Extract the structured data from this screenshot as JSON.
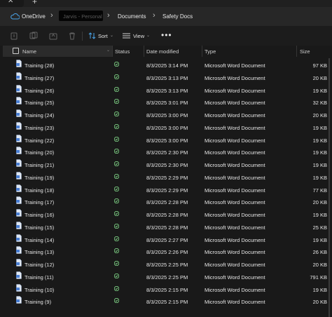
{
  "tabstrip": {
    "close": "✕",
    "new_tab": "+"
  },
  "breadcrumb": {
    "items": [
      "OneDrive",
      "Jarvis - Personal",
      "Documents",
      "Safety Docs"
    ]
  },
  "toolbar": {
    "sort_label": "Sort",
    "view_label": "View",
    "more_label": "•••"
  },
  "columns": {
    "name": "Name",
    "status": "Status",
    "date": "Date modified",
    "type": "Type",
    "size": "Size"
  },
  "colors": {
    "accent": "#4aa3e8",
    "status_ok": "#7ed185",
    "word_blue": "#4a7fd4"
  },
  "files": [
    {
      "name": "Training (28)",
      "date": "8/3/2025 3:14 PM",
      "type": "Microsoft Word Document",
      "size": "97 KB"
    },
    {
      "name": "Training (27)",
      "date": "8/3/2025 3:13 PM",
      "type": "Microsoft Word Document",
      "size": "20 KB"
    },
    {
      "name": "Training (26)",
      "date": "8/3/2025 3:13 PM",
      "type": "Microsoft Word Document",
      "size": "19 KB"
    },
    {
      "name": "Training (25)",
      "date": "8/3/2025 3:01 PM",
      "type": "Microsoft Word Document",
      "size": "32 KB"
    },
    {
      "name": "Training (24)",
      "date": "8/3/2025 3:00 PM",
      "type": "Microsoft Word Document",
      "size": "20 KB"
    },
    {
      "name": "Training (23)",
      "date": "8/3/2025 3:00 PM",
      "type": "Microsoft Word Document",
      "size": "19 KB"
    },
    {
      "name": "Training (22)",
      "date": "8/3/2025 3:00 PM",
      "type": "Microsoft Word Document",
      "size": "19 KB"
    },
    {
      "name": "Training (20)",
      "date": "8/3/2025 2:30 PM",
      "type": "Microsoft Word Document",
      "size": "19 KB"
    },
    {
      "name": "Training (21)",
      "date": "8/3/2025 2:30 PM",
      "type": "Microsoft Word Document",
      "size": "19 KB"
    },
    {
      "name": "Training (19)",
      "date": "8/3/2025 2:29 PM",
      "type": "Microsoft Word Document",
      "size": "19 KB"
    },
    {
      "name": "Training (18)",
      "date": "8/3/2025 2:29 PM",
      "type": "Microsoft Word Document",
      "size": "77 KB"
    },
    {
      "name": "Training (17)",
      "date": "8/3/2025 2:28 PM",
      "type": "Microsoft Word Document",
      "size": "20 KB"
    },
    {
      "name": "Training (16)",
      "date": "8/3/2025 2:28 PM",
      "type": "Microsoft Word Document",
      "size": "19 KB"
    },
    {
      "name": "Training (15)",
      "date": "8/3/2025 2:28 PM",
      "type": "Microsoft Word Document",
      "size": "25 KB"
    },
    {
      "name": "Training (14)",
      "date": "8/3/2025 2:27 PM",
      "type": "Microsoft Word Document",
      "size": "19 KB"
    },
    {
      "name": "Training (13)",
      "date": "8/3/2025 2:26 PM",
      "type": "Microsoft Word Document",
      "size": "26 KB"
    },
    {
      "name": "Training (12)",
      "date": "8/3/2025 2:25 PM",
      "type": "Microsoft Word Document",
      "size": "20 KB"
    },
    {
      "name": "Training (11)",
      "date": "8/3/2025 2:25 PM",
      "type": "Microsoft Word Document",
      "size": "791 KB"
    },
    {
      "name": "Training (10)",
      "date": "8/3/2025 2:15 PM",
      "type": "Microsoft Word Document",
      "size": "19 KB"
    },
    {
      "name": "Training (9)",
      "date": "8/3/2025 2:15 PM",
      "type": "Microsoft Word Document",
      "size": "20 KB"
    }
  ]
}
